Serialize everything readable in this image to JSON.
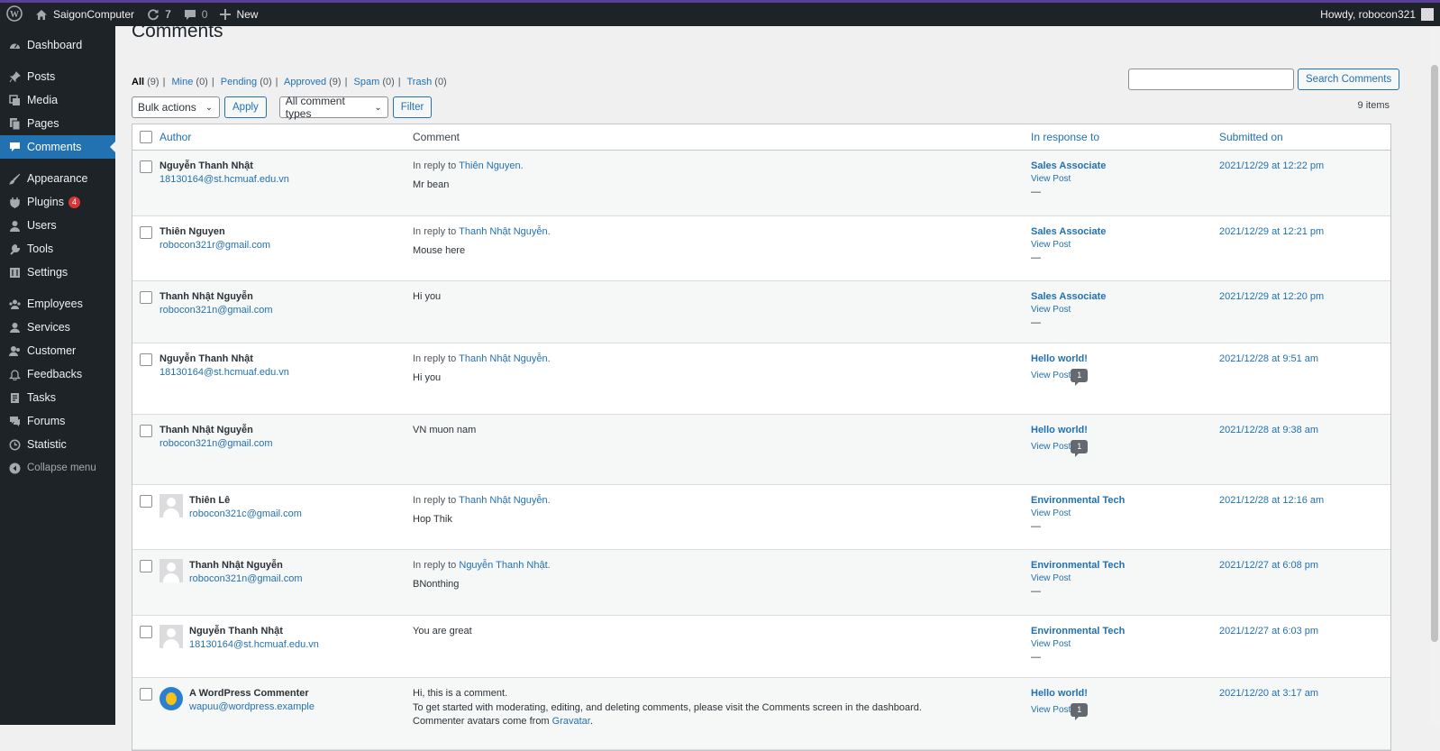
{
  "adminbar": {
    "site_name": "SaigonComputer",
    "updates_count": "7",
    "comments_count": "0",
    "new_label": "New",
    "howdy": "Howdy, robocon321"
  },
  "sidebar": {
    "items": [
      {
        "label": "Dashboard",
        "icon": "dashboard-icon"
      },
      {
        "label": "Posts",
        "icon": "pin-icon"
      },
      {
        "label": "Media",
        "icon": "media-icon"
      },
      {
        "label": "Pages",
        "icon": "pages-icon"
      },
      {
        "label": "Comments",
        "icon": "comments-icon",
        "current": true
      },
      {
        "label": "Appearance",
        "icon": "brush-icon"
      },
      {
        "label": "Plugins",
        "icon": "plugin-icon",
        "badge": "4"
      },
      {
        "label": "Users",
        "icon": "users-icon"
      },
      {
        "label": "Tools",
        "icon": "wrench-icon"
      },
      {
        "label": "Settings",
        "icon": "settings-icon"
      },
      {
        "label": "Employees",
        "icon": "groups-icon"
      },
      {
        "label": "Services",
        "icon": "services-icon"
      },
      {
        "label": "Customer",
        "icon": "customer-icon"
      },
      {
        "label": "Feedbacks",
        "icon": "bell-icon"
      },
      {
        "label": "Tasks",
        "icon": "tasks-icon"
      },
      {
        "label": "Forums",
        "icon": "forums-icon"
      },
      {
        "label": "Statistic",
        "icon": "clock-icon"
      },
      {
        "label": "Collapse menu",
        "icon": "collapse-icon"
      }
    ]
  },
  "page": {
    "title": "Comments",
    "filters": [
      {
        "label": "All",
        "count": "(9)"
      },
      {
        "label": "Mine",
        "count": "(0)"
      },
      {
        "label": "Pending",
        "count": "(0)"
      },
      {
        "label": "Approved",
        "count": "(9)"
      },
      {
        "label": "Spam",
        "count": "(0)"
      },
      {
        "label": "Trash",
        "count": "(0)"
      }
    ],
    "search_button": "Search Comments",
    "search_value": "",
    "bulk_actions": "Bulk actions",
    "apply": "Apply",
    "comment_types": "All comment types",
    "filter": "Filter",
    "items_count": "9 items",
    "columns": {
      "author": "Author",
      "comment": "Comment",
      "response": "In response to",
      "date": "Submitted on"
    }
  },
  "rows": [
    {
      "name": "Nguyễn Thanh Nhật",
      "email": "18130164@st.hcmuaf.edu.vn",
      "avatar": "",
      "reply_prefix": "In reply to",
      "reply_to": "Thiên Nguyen.",
      "text": [
        "Mr bean"
      ],
      "resp": "Sales Associate",
      "view_post": "View Post",
      "resp_extra": "—",
      "date": "2021/12/29 at 12:22 pm",
      "height": 73
    },
    {
      "name": "Thiên Nguyen",
      "email": "robocon321r@gmail.com",
      "avatar": "",
      "reply_prefix": "In reply to",
      "reply_to": "Thanh Nhật Nguyễn.",
      "text": [
        "Mouse here"
      ],
      "resp": "Sales Associate",
      "view_post": "View Post",
      "resp_extra": "—",
      "date": "2021/12/29 at 12:21 pm",
      "height": 72
    },
    {
      "name": "Thanh Nhật Nguyễn",
      "email": "robocon321n@gmail.com",
      "avatar": "",
      "reply_prefix": "",
      "reply_to": "",
      "text": [
        "Hi you"
      ],
      "resp": "Sales Associate",
      "view_post": "View Post",
      "resp_extra": "—",
      "date": "2021/12/29 at 12:20 pm",
      "height": 69
    },
    {
      "name": "Nguyễn Thanh Nhật",
      "email": "18130164@st.hcmuaf.edu.vn",
      "avatar": "",
      "reply_prefix": "In reply to",
      "reply_to": "Thanh Nhật Nguyễn.",
      "text": [
        "Hi you"
      ],
      "resp": "Hello world!",
      "view_post": "View Post",
      "resp_extra": "1",
      "date": "2021/12/28 at 9:51 am",
      "height": 79
    },
    {
      "name": "Thanh Nhật Nguyễn",
      "email": "robocon321n@gmail.com",
      "avatar": "",
      "reply_prefix": "",
      "reply_to": "",
      "text": [
        "VN muon nam"
      ],
      "resp": "Hello world!",
      "view_post": "View Post",
      "resp_extra": "1",
      "date": "2021/12/28 at 9:38 am",
      "height": 78
    },
    {
      "name": "Thiên Lê",
      "email": "robocon321c@gmail.com",
      "avatar": "gray",
      "reply_prefix": "In reply to",
      "reply_to": "Thanh Nhật Nguyễn.",
      "text": [
        "Hop Thik"
      ],
      "resp": "Environmental Tech",
      "view_post": "View Post",
      "resp_extra": "—",
      "date": "2021/12/28 at 12:16 am",
      "height": 72
    },
    {
      "name": "Thanh Nhật Nguyễn",
      "email": "robocon321n@gmail.com",
      "avatar": "gray",
      "reply_prefix": "In reply to",
      "reply_to": "Nguyễn Thanh Nhật.",
      "text": [
        "BNonthing"
      ],
      "resp": "Environmental Tech",
      "view_post": "View Post",
      "resp_extra": "—",
      "date": "2021/12/27 at 6:08 pm",
      "height": 73
    },
    {
      "name": "Nguyễn Thanh Nhật",
      "email": "18130164@st.hcmuaf.edu.vn",
      "avatar": "gray",
      "reply_prefix": "",
      "reply_to": "",
      "text": [
        "You are great"
      ],
      "resp": "Environmental Tech",
      "view_post": "View Post",
      "resp_extra": "—",
      "date": "2021/12/27 at 6:03 pm",
      "height": 69
    },
    {
      "name": "A WordPress Commenter",
      "email": "wapuu@wordpress.example",
      "avatar": "wapuu",
      "reply_prefix": "",
      "reply_to": "",
      "text": [
        "Hi, this is a comment.",
        "To get started with moderating, editing, and deleting comments, please visit the Comments screen in the dashboard.",
        "Commenter avatars come from "
      ],
      "text_link": "Gravatar",
      "text_link_suffix": ".",
      "resp": "Hello world!",
      "view_post": "View Post",
      "resp_extra": "1",
      "date": "2021/12/20 at 3:17 am",
      "height": 80
    }
  ]
}
